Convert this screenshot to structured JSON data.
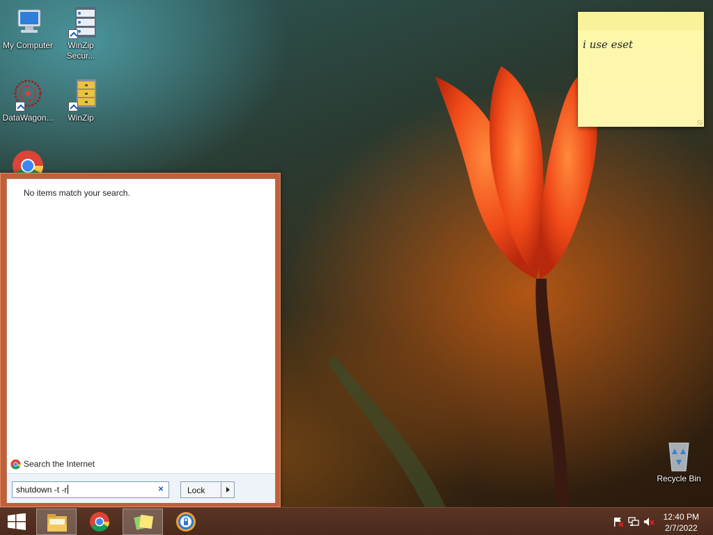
{
  "desktop": {
    "icons": [
      {
        "label": "My Computer",
        "icon": "my-computer-icon"
      },
      {
        "label": "WinZip Secur...",
        "icon": "winzip-secure-icon"
      },
      {
        "label": "DataWagon...",
        "icon": "datawagon-icon"
      },
      {
        "label": "WinZip",
        "icon": "winzip-icon"
      },
      {
        "label": "",
        "icon": "chrome-icon"
      },
      {
        "label": "Recycle Bin",
        "icon": "recycle-bin-icon"
      }
    ]
  },
  "sticky_note": {
    "text": "i use eset"
  },
  "start_menu": {
    "no_results": "No items match your search.",
    "search_internet": "Search the Internet",
    "search_value": "shutdown -t -r",
    "clear_icon": "×",
    "power_button_label": "Lock"
  },
  "taskbar": {
    "buttons": [
      {
        "name": "start-button",
        "icon": "windows-logo-icon"
      },
      {
        "name": "file-explorer",
        "icon": "folder-icon"
      },
      {
        "name": "chrome",
        "icon": "chrome-icon"
      },
      {
        "name": "sticky-notes",
        "icon": "sticky-notes-icon",
        "active": true
      },
      {
        "name": "avast-secure-browser",
        "icon": "secure-browser-icon"
      }
    ],
    "tray": {
      "icons": [
        "action-center-flag-icon",
        "network-icon",
        "volume-muted-icon"
      ],
      "time": "12:40 PM",
      "date": "2/7/2022"
    }
  },
  "colors": {
    "accent": "#c0603a",
    "taskbar": "#4a2a1c",
    "sticky": "#fdf8a8"
  }
}
